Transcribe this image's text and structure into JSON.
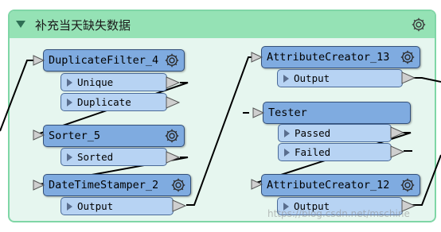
{
  "bookmark": {
    "title": "补充当天缺失数据",
    "header_color": "#95e2b5",
    "body_color": "#e6f6ef"
  },
  "transformers": [
    {
      "name": "DuplicateFilter_4",
      "ports": [
        "Unique",
        "Duplicate"
      ]
    },
    {
      "name": "Sorter_5",
      "ports": [
        "Sorted"
      ]
    },
    {
      "name": "DateTimeStamper_2",
      "ports": [
        "Output"
      ]
    },
    {
      "name": "AttributeCreator_13",
      "ports": [
        "Output"
      ]
    },
    {
      "name": "Tester",
      "ports": [
        "Passed",
        "Failed"
      ]
    },
    {
      "name": "AttributeCreator_12",
      "ports": [
        "Output"
      ]
    }
  ],
  "icons": {
    "collapse": "collapse-arrow-icon",
    "settings": "gear-icon",
    "input_port": "input-port-icon",
    "output_port": "output-port-icon",
    "port_expand": "play-triangle-icon"
  },
  "colors": {
    "node": "#7fabe0",
    "port": "#b7d3f3",
    "connection": "#000000"
  },
  "watermark": "https://blog.csdn.net/mschine"
}
